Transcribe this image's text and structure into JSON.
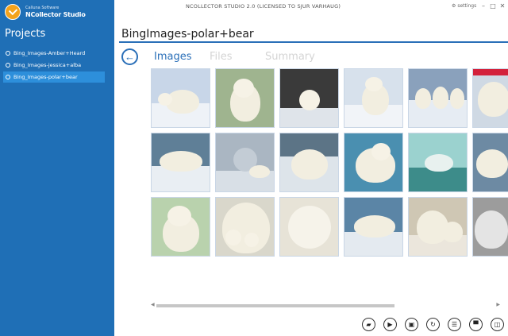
{
  "brand": {
    "company": "Calluna Software",
    "product": "NCollector Studio"
  },
  "window": {
    "title": "NCOLLECTOR STUDIO 2.0 (LICENSED TO SJUR VARHAUG)",
    "settings_label": "settings",
    "minimize": "–",
    "maximize": "□",
    "close": "✕"
  },
  "sidebar": {
    "title": "Projects",
    "items": [
      {
        "label": "Bing_Images-Amber+Heard",
        "selected": false
      },
      {
        "label": "Bing_Images-jessica+alba",
        "selected": false
      },
      {
        "label": "Bing_Images-polar+bear",
        "selected": true
      }
    ]
  },
  "main": {
    "project_title": "BingImages-polar+bear",
    "back_icon": "←",
    "tabs": [
      {
        "label": "Images",
        "active": true
      },
      {
        "label": "Files",
        "active": false
      },
      {
        "label": "Summary",
        "active": false
      }
    ]
  },
  "toolbar": {
    "buttons": [
      {
        "name": "open-folder-icon",
        "glyph": "▰"
      },
      {
        "name": "play-icon",
        "glyph": "▶"
      },
      {
        "name": "save-icon",
        "glyph": "▣"
      },
      {
        "name": "redo-icon",
        "glyph": "↻"
      },
      {
        "name": "list-icon",
        "glyph": "☰"
      },
      {
        "name": "window-icon",
        "glyph": "▀"
      },
      {
        "name": "panel-icon",
        "glyph": "◫"
      }
    ]
  },
  "colors": {
    "sidebar": "#1f6fb6",
    "accent": "#2a6fb8",
    "selected_item": "#2d8fdb",
    "logo": "#f4a31c"
  }
}
